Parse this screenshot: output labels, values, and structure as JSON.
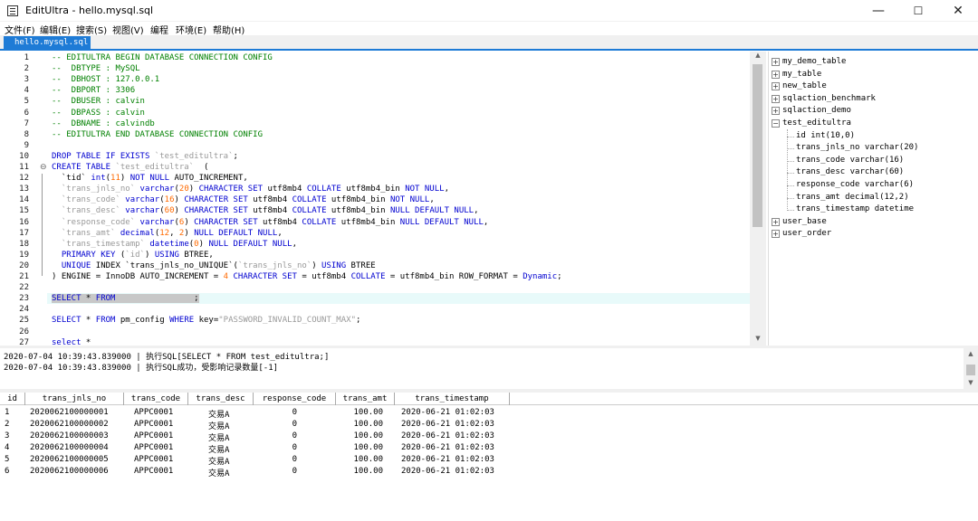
{
  "window": {
    "title": "EditUltra - hello.mysql.sql",
    "min": "—",
    "max": "☐",
    "close": "✕"
  },
  "menu": [
    "文件(F)",
    "编辑(E)",
    "搜索(S)",
    "视图(V)",
    "编程",
    "环境(E)",
    "帮助(H)"
  ],
  "tab": {
    "label": "hello.mysql.sql"
  },
  "editor": {
    "lines": [
      [
        [
          "cm",
          "-- EDITULTRA BEGIN DATABASE CONNECTION CONFIG"
        ]
      ],
      [
        [
          "cm",
          "--  DBTYPE : MySQL"
        ]
      ],
      [
        [
          "cm",
          "--  DBHOST : 127.0.0.1"
        ]
      ],
      [
        [
          "cm",
          "--  DBPORT : 3306"
        ]
      ],
      [
        [
          "cm",
          "--  DBUSER : calvin"
        ]
      ],
      [
        [
          "cm",
          "--  DBPASS : calvin"
        ]
      ],
      [
        [
          "cm",
          "--  DBNAME : calvindb"
        ]
      ],
      [
        [
          "cm",
          "-- EDITULTRA END DATABASE CONNECTION CONFIG"
        ]
      ],
      [],
      [
        [
          "kw",
          "DROP TABLE IF EXISTS "
        ],
        [
          "str",
          "`test_editultra`"
        ],
        [
          "pl",
          ";"
        ]
      ],
      [
        [
          "kw",
          "CREATE TABLE "
        ],
        [
          "str",
          "`test_editultra`"
        ],
        [
          "pl",
          "  ("
        ]
      ],
      [
        [
          "pl",
          "  `tid` "
        ],
        [
          "kw",
          "int"
        ],
        [
          "pl",
          "("
        ],
        [
          "num",
          "11"
        ],
        [
          "pl",
          ") "
        ],
        [
          "kw",
          "NOT NULL"
        ],
        [
          "pl",
          " AUTO_INCREMENT,"
        ]
      ],
      [
        [
          "pl",
          "  "
        ],
        [
          "str",
          "`trans_jnls_no`"
        ],
        [
          "pl",
          " "
        ],
        [
          "kw",
          "varchar"
        ],
        [
          "pl",
          "("
        ],
        [
          "num",
          "20"
        ],
        [
          "pl",
          ") "
        ],
        [
          "kw",
          "CHARACTER SET"
        ],
        [
          "pl",
          " utf8mb4 "
        ],
        [
          "kw",
          "COLLATE"
        ],
        [
          "pl",
          " utf8mb4_bin "
        ],
        [
          "kw",
          "NOT NULL"
        ],
        [
          "pl",
          ","
        ]
      ],
      [
        [
          "pl",
          "  "
        ],
        [
          "str",
          "`trans_code`"
        ],
        [
          "pl",
          " "
        ],
        [
          "kw",
          "varchar"
        ],
        [
          "pl",
          "("
        ],
        [
          "num",
          "16"
        ],
        [
          "pl",
          ") "
        ],
        [
          "kw",
          "CHARACTER SET"
        ],
        [
          "pl",
          " utf8mb4 "
        ],
        [
          "kw",
          "COLLATE"
        ],
        [
          "pl",
          " utf8mb4_bin "
        ],
        [
          "kw",
          "NOT NULL"
        ],
        [
          "pl",
          ","
        ]
      ],
      [
        [
          "pl",
          "  "
        ],
        [
          "str",
          "`trans_desc`"
        ],
        [
          "pl",
          " "
        ],
        [
          "kw",
          "varchar"
        ],
        [
          "pl",
          "("
        ],
        [
          "num",
          "60"
        ],
        [
          "pl",
          ") "
        ],
        [
          "kw",
          "CHARACTER SET"
        ],
        [
          "pl",
          " utf8mb4 "
        ],
        [
          "kw",
          "COLLATE"
        ],
        [
          "pl",
          " utf8mb4_bin "
        ],
        [
          "kw",
          "NULL DEFAULT NULL"
        ],
        [
          "pl",
          ","
        ]
      ],
      [
        [
          "pl",
          "  "
        ],
        [
          "str",
          "`response_code`"
        ],
        [
          "pl",
          " "
        ],
        [
          "kw",
          "varchar"
        ],
        [
          "pl",
          "("
        ],
        [
          "num",
          "6"
        ],
        [
          "pl",
          ") "
        ],
        [
          "kw",
          "CHARACTER SET"
        ],
        [
          "pl",
          " utf8mb4 "
        ],
        [
          "kw",
          "COLLATE"
        ],
        [
          "pl",
          " utf8mb4_bin "
        ],
        [
          "kw",
          "NULL DEFAULT NULL"
        ],
        [
          "pl",
          ","
        ]
      ],
      [
        [
          "pl",
          "  "
        ],
        [
          "str",
          "`trans_amt`"
        ],
        [
          "pl",
          " "
        ],
        [
          "kw",
          "decimal"
        ],
        [
          "pl",
          "("
        ],
        [
          "num",
          "12"
        ],
        [
          "pl",
          ", "
        ],
        [
          "num",
          "2"
        ],
        [
          "pl",
          ") "
        ],
        [
          "kw",
          "NULL DEFAULT NULL"
        ],
        [
          "pl",
          ","
        ]
      ],
      [
        [
          "pl",
          "  "
        ],
        [
          "str",
          "`trans_timestamp`"
        ],
        [
          "pl",
          " "
        ],
        [
          "kw",
          "datetime"
        ],
        [
          "pl",
          "("
        ],
        [
          "num",
          "0"
        ],
        [
          "pl",
          ") "
        ],
        [
          "kw",
          "NULL DEFAULT NULL"
        ],
        [
          "pl",
          ","
        ]
      ],
      [
        [
          "pl",
          "  "
        ],
        [
          "kw",
          "PRIMARY KEY"
        ],
        [
          "pl",
          " ("
        ],
        [
          "str",
          "`id`"
        ],
        [
          "pl",
          ") "
        ],
        [
          "kw",
          "USING"
        ],
        [
          "pl",
          " BTREE,"
        ]
      ],
      [
        [
          "pl",
          "  "
        ],
        [
          "kw",
          "UNIQUE"
        ],
        [
          "pl",
          " INDEX `trans_jnls_no_UNIQUE`("
        ],
        [
          "str",
          "`trans_jnls_no`"
        ],
        [
          "pl",
          ") "
        ],
        [
          "kw",
          "USING"
        ],
        [
          "pl",
          " BTREE"
        ]
      ],
      [
        [
          "pl",
          ") ENGINE = InnoDB AUTO_INCREMENT = "
        ],
        [
          "num",
          "4"
        ],
        [
          "pl",
          " "
        ],
        [
          "kw",
          "CHARACTER SET"
        ],
        [
          "pl",
          " = utf8mb4 "
        ],
        [
          "kw",
          "COLLATE"
        ],
        [
          "pl",
          " = utf8mb4_bin ROW_FORMAT = "
        ],
        [
          "kw",
          "Dynamic"
        ],
        [
          "pl",
          ";"
        ]
      ],
      [],
      [
        [
          "kw",
          "SELECT"
        ],
        [
          "pl",
          " * "
        ],
        [
          "kw",
          "FROM"
        ],
        [
          "pl",
          "                ;"
        ]
      ],
      [],
      [
        [
          "kw",
          "SELECT"
        ],
        [
          "pl",
          " * "
        ],
        [
          "kw",
          "FROM"
        ],
        [
          "pl",
          " pm_config "
        ],
        [
          "kw",
          "WHERE"
        ],
        [
          "pl",
          " key="
        ],
        [
          "str",
          "\"PASSWORD_INVALID_COUNT_MAX\""
        ],
        [
          "pl",
          ";"
        ]
      ],
      [],
      [
        [
          "kw",
          "select"
        ],
        [
          "pl",
          " *"
        ]
      ]
    ]
  },
  "tree": {
    "tables": [
      "my_demo_table",
      "my_table",
      "new_table",
      "sqlaction_benchmark",
      "sqlaction_demo",
      "test_editultra"
    ],
    "columns": [
      "id int(10,0)",
      "trans_jnls_no varchar(20)",
      "trans_code varchar(16)",
      "trans_desc varchar(60)",
      "response_code varchar(6)",
      "trans_amt decimal(12,2)",
      "trans_timestamp datetime"
    ],
    "tables_after": [
      "user_base",
      "user_order"
    ]
  },
  "log": [
    "2020-07-04 10:39:43.839000 | 执行SQL[SELECT * FROM test_editultra;]",
    "2020-07-04 10:39:43.839000 | 执行SQL成功，受影响记录数量[-1]"
  ],
  "grid": {
    "headers": [
      "id",
      "trans_jnls_no",
      "trans_code",
      "trans_desc",
      "response_code",
      "trans_amt",
      "trans_timestamp"
    ],
    "rows": [
      [
        "1",
        "2020062100000001",
        "APPC0001",
        "交易A",
        "0",
        "100.00",
        "2020-06-21 01:02:03"
      ],
      [
        "2",
        "2020062100000002",
        "APPC0001",
        "交易A",
        "0",
        "100.00",
        "2020-06-21 01:02:03"
      ],
      [
        "3",
        "2020062100000003",
        "APPC0001",
        "交易A",
        "0",
        "100.00",
        "2020-06-21 01:02:03"
      ],
      [
        "4",
        "2020062100000004",
        "APPC0001",
        "交易A",
        "0",
        "100.00",
        "2020-06-21 01:02:03"
      ],
      [
        "5",
        "2020062100000005",
        "APPC0001",
        "交易A",
        "0",
        "100.00",
        "2020-06-21 01:02:03"
      ],
      [
        "6",
        "2020062100000006",
        "APPC0001",
        "交易A",
        "0",
        "100.00",
        "2020-06-21 01:02:03"
      ]
    ]
  }
}
